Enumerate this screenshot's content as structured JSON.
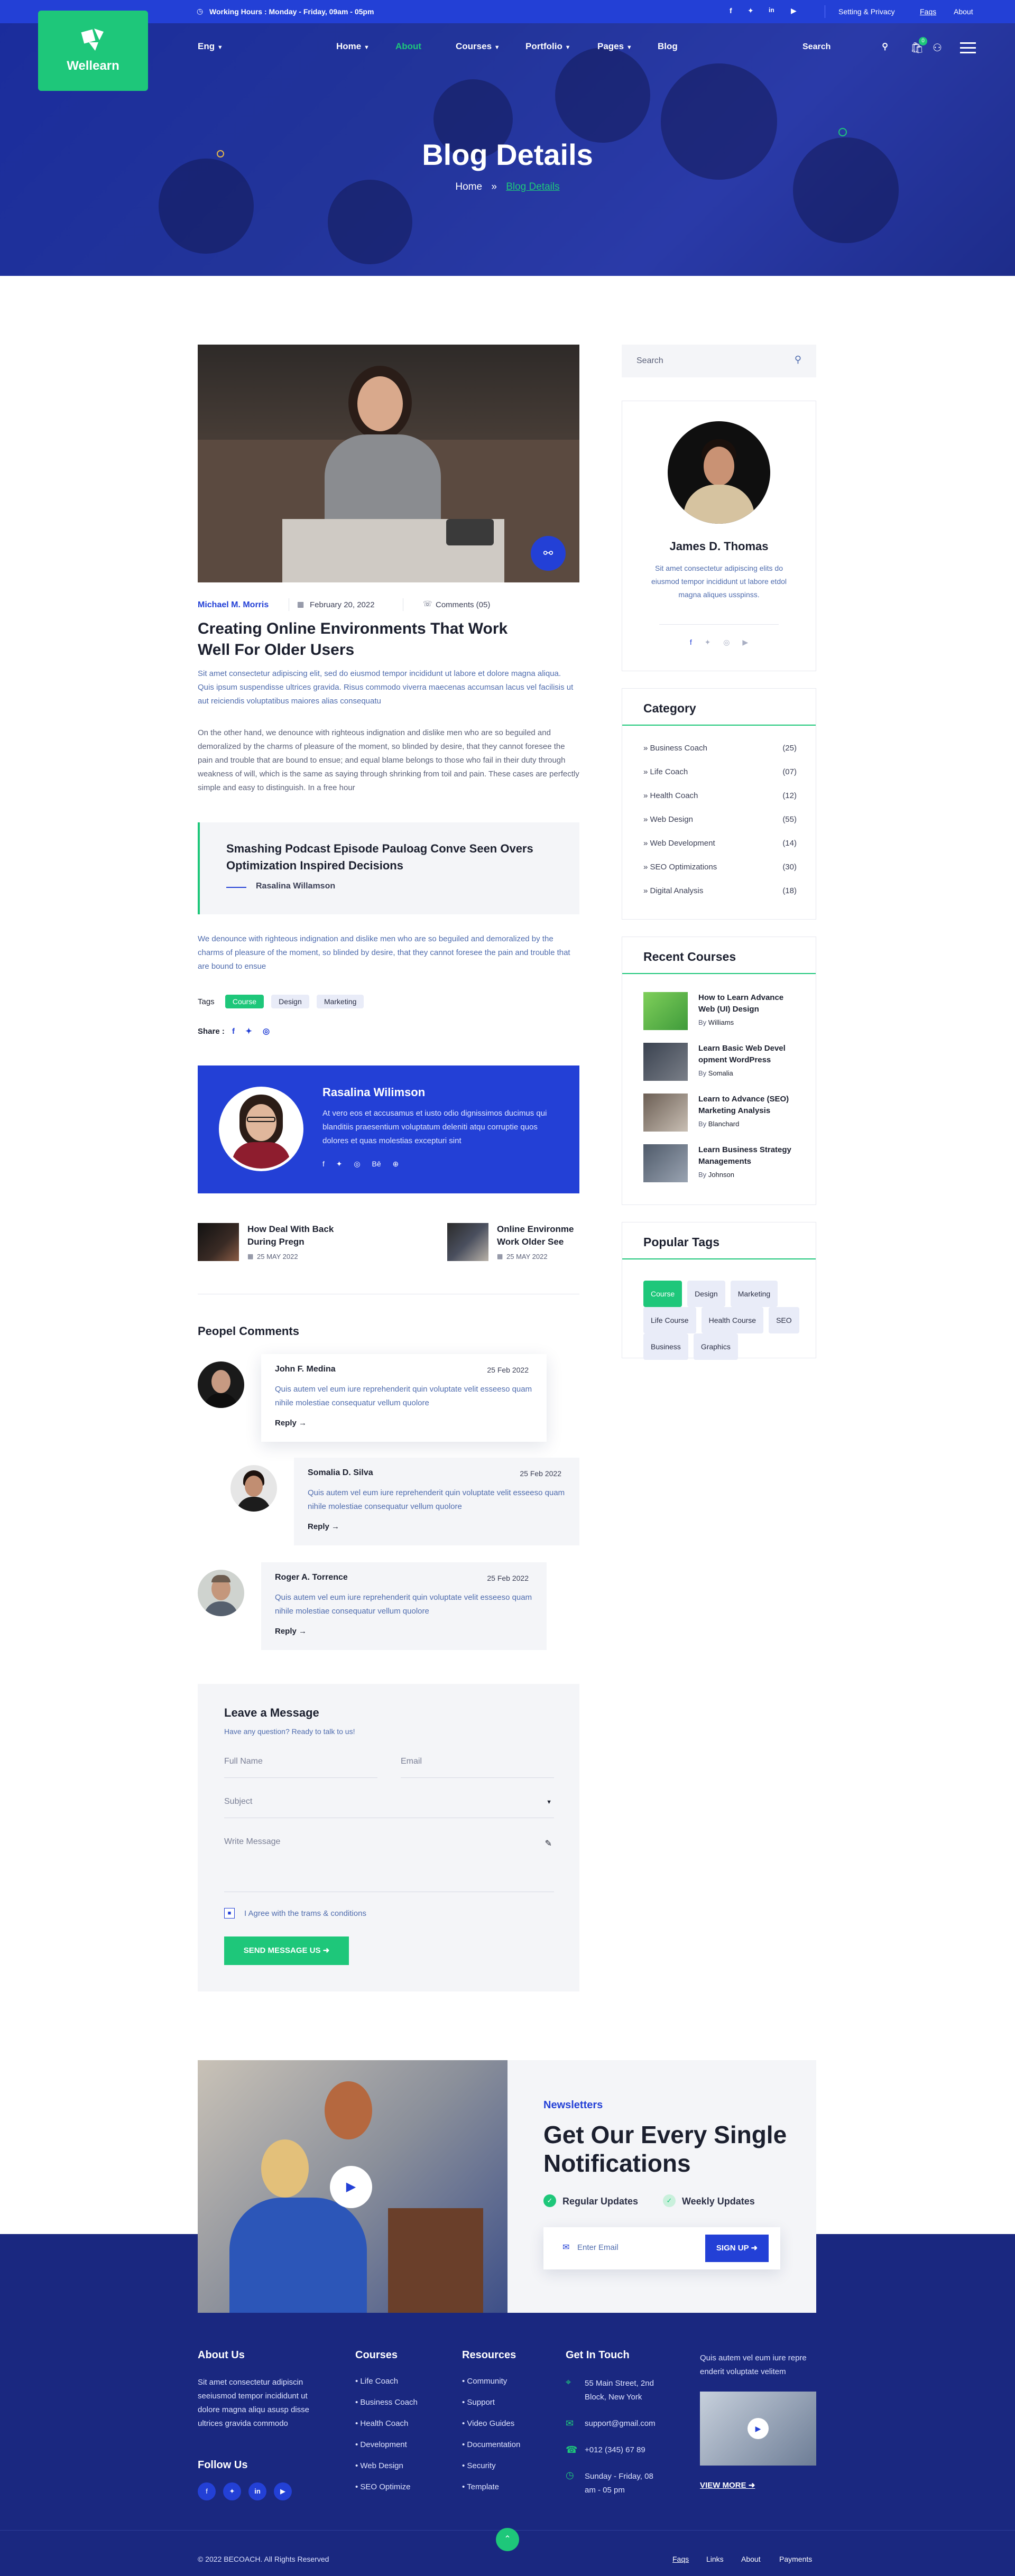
{
  "topbar": {
    "hours": "Working Hours : Monday - Friday, 09am - 05pm",
    "links": [
      "Setting & Privacy",
      "Faqs",
      "About"
    ]
  },
  "brand": {
    "name": "Wellearn",
    "accent": "#1ec77a",
    "primary": "#2340d6",
    "footer_bg": "#1a2880"
  },
  "header": {
    "lang": "Eng",
    "nav": [
      "Home",
      "About",
      "Courses",
      "Portfolio",
      "Pages",
      "Blog"
    ],
    "search_placeholder": "Search",
    "cart_count": "0"
  },
  "hero": {
    "title": "Blog Details",
    "crumb_home": "Home",
    "crumb_current": "Blog Details"
  },
  "post": {
    "author": "Michael M. Morris",
    "date": "February 20, 2022",
    "comments": "Comments (05)",
    "title": "Creating Online Environments That Work Well For Older Users",
    "p1": "Sit amet consectetur adipiscing elit, sed do eiusmod tempor incididunt ut labore et dolore magna aliqua. Quis ipsum suspendisse ultrices gravida. Risus commodo viverra maecenas accumsan lacus vel facilisis ut aut reiciendis voluptatibus maiores alias consequatu",
    "p2": "On the other hand, we denounce with righteous indignation and dislike men who are so beguiled and demoralized by the charms of pleasure of the moment, so blinded by desire, that they cannot foresee the pain and trouble that are bound to ensue; and equal blame belongs to those who fail in their duty through weakness of will, which is the same as saying through shrinking from toil and pain. These cases are perfectly simple and easy to distinguish. In a free hour",
    "quote": "Smashing Podcast Episode Pauloag Conve Seen Overs Optimization Inspired Decisions",
    "quote_author": "Rasalina Willamson",
    "p3": "We denounce with righteous indignation and dislike men who are so beguiled and demoralized by the charms of pleasure of the moment, so blinded by desire, that they cannot foresee the pain and trouble that are bound to ensue",
    "tags_label": "Tags",
    "tags": [
      "Course",
      "Design",
      "Marketing"
    ],
    "share_label": "Share :"
  },
  "author_box": {
    "name": "Rasalina Wilimson",
    "bio": "At vero eos et accusamus et iusto odio dignissimos ducimus qui blanditiis praesentium voluptatum deleniti atqu corruptie quos dolores et quas molestias excepturi sint"
  },
  "nav_posts": [
    {
      "title": "How Deal With Back During Pregn",
      "date": "25 MAY 2022"
    },
    {
      "title": "Online Environme Work Older See",
      "date": "25 MAY 2022"
    }
  ],
  "comments": {
    "heading": "Peopel Comments",
    "items": [
      {
        "name": "John F. Medina",
        "date": "25 Feb 2022",
        "text": "Quis autem vel eum iure reprehenderit quin voluptate velit esseeso quam nihile molestiae consequatur vellum quolore",
        "reply": "Reply"
      },
      {
        "name": "Somalia D. Silva",
        "date": "25 Feb 2022",
        "text": "Quis autem vel eum iure reprehenderit quin voluptate velit esseeso quam nihile molestiae consequatur vellum quolore",
        "reply": "Reply"
      },
      {
        "name": "Roger A. Torrence",
        "date": "25 Feb 2022",
        "text": "Quis autem vel eum iure reprehenderit quin voluptate velit esseeso quam nihile molestiae consequatur vellum quolore",
        "reply": "Reply"
      }
    ]
  },
  "form": {
    "title": "Leave a Message",
    "subtitle": "Have any question? Ready to talk to us!",
    "name": "Full Name",
    "email": "Email",
    "subject": "Subject",
    "message": "Write Message",
    "agree": "I Agree with the trams & conditions",
    "submit": "SEND MESSAGE US"
  },
  "sidebar": {
    "search_placeholder": "Search",
    "profile": {
      "name": "James D. Thomas",
      "bio": "Sit amet consectetur adipiscing elits do eiusmod tempor incididunt ut labore etdol magna aliques usspinss."
    },
    "category_title": "Category",
    "categories": [
      {
        "name": "Business Coach",
        "count": "(25)"
      },
      {
        "name": "Life Coach",
        "count": "(07)"
      },
      {
        "name": "Health Coach",
        "count": "(12)"
      },
      {
        "name": "Web Design",
        "count": "(55)"
      },
      {
        "name": "Web Development",
        "count": "(14)"
      },
      {
        "name": "SEO Optimizations",
        "count": "(30)"
      },
      {
        "name": "Digital Analysis",
        "count": "(18)"
      }
    ],
    "courses_title": "Recent Courses",
    "courses": [
      {
        "title": "How to Learn Advance Web (UI) Design",
        "by": "By",
        "author": "Williams"
      },
      {
        "title": "Learn Basic Web Devel opment WordPress",
        "by": "By",
        "author": "Somalia"
      },
      {
        "title": "Learn to Advance (SEO) Marketing Analysis",
        "by": "By",
        "author": "Blanchard"
      },
      {
        "title": "Learn Business Strategy Managements",
        "by": "By",
        "author": "Johnson"
      }
    ],
    "tags_title": "Popular Tags",
    "tags": [
      "Course",
      "Design",
      "Marketing",
      "Life Course",
      "Health Course",
      "SEO",
      "Business",
      "Graphics"
    ]
  },
  "newsletter": {
    "kicker": "Newsletters",
    "title": "Get Our Every Single Notifications",
    "check1": "Regular Updates",
    "check2": "Weekly Updates",
    "placeholder": "Enter Email",
    "button": "SIGN UP"
  },
  "footer": {
    "about_title": "About Us",
    "about_text": "Sit amet consectetur adipiscin seeiusmod tempor incididunt ut dolore magna aliqu asusp disse ultrices gravida commodo",
    "follow": "Follow Us",
    "courses_title": "Courses",
    "courses": [
      "Life Coach",
      "Business Coach",
      "Health Coach",
      "Development",
      "Web Design",
      "SEO Optimize"
    ],
    "resources_title": "Resources",
    "resources": [
      "Community",
      "Support",
      "Video Guides",
      "Documentation",
      "Security",
      "Template"
    ],
    "contact_title": "Get In Touch",
    "address": "55 Main Street, 2nd Block, New York",
    "email": "support@gmail.com",
    "phone": "+012 (345) 67 89",
    "hours": "Sunday - Friday, 08 am - 05 pm",
    "promo_text": "Quis autem vel eum iure repre enderit voluptate velitem",
    "view_more": "VIEW MORE",
    "copyright": "© 2022 BECOACH. All Rights Reserved",
    "bottom_links": [
      "Faqs",
      "Links",
      "About",
      "Payments"
    ]
  }
}
